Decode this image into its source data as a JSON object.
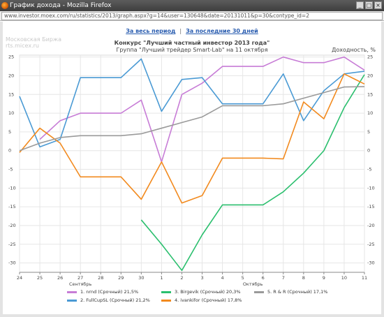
{
  "window": {
    "title": "График дохода - Mozilla Firefox",
    "url": "www.investor.moex.com/ru/statistics/2013/graph.aspx?g=14&user=130648&date=20131011&p=30&contype_id=2"
  },
  "nav": {
    "all_period": "За весь период",
    "separator": "|",
    "last_30_days": "За последние 30 дней"
  },
  "watermark": {
    "line1": "Московская Биржа",
    "line2": "rts.micex.ru"
  },
  "chart_data": {
    "type": "line",
    "title": "Конкурс \"Лучший частный инвестор 2013 года\"",
    "subtitle": "Группа \"Лучший трейдер Smart-Lab\" на 11 октября",
    "ylabel": "Доходность, %",
    "categories": [
      "24",
      "25",
      "26",
      "27",
      "28",
      "29",
      "30",
      "1",
      "2",
      "3",
      "4",
      "5",
      "6",
      "7",
      "8",
      "9",
      "10",
      "11"
    ],
    "month_labels": [
      {
        "text": "Сентябрь",
        "index": 3
      },
      {
        "text": "Октябрь",
        "index": 11.5
      }
    ],
    "yticks": [
      25,
      20,
      15,
      10,
      5,
      0,
      -5,
      -10,
      -15,
      -20,
      -25,
      -30
    ],
    "ylim": [
      -32.5,
      25.5
    ],
    "grid": true,
    "legend_position": "bottom",
    "series": [
      {
        "name": "1. nrnd (Срочный)",
        "value": "21,5%",
        "color": "#c77cd6",
        "values": [
          null,
          null,
          3,
          8,
          10,
          10,
          10,
          13.5,
          -3,
          15,
          18,
          22.5,
          22.5,
          22.5,
          25,
          23.5,
          23.5,
          25,
          21.5
        ]
      },
      {
        "name": "2. FullCupSL (Срочный)",
        "value": "21,2%",
        "color": "#4a9ad4",
        "values": [
          null,
          14.5,
          1,
          3,
          19.5,
          19.5,
          19.5,
          24.5,
          10.5,
          19,
          19.5,
          12.5,
          12.5,
          12.5,
          20.5,
          8,
          16,
          20.5,
          21.2
        ]
      },
      {
        "name": "3. Birgevik (Срочный)",
        "value": "20,3%",
        "color": "#2bbf6e",
        "values": [
          null,
          null,
          null,
          null,
          null,
          null,
          null,
          -18.5,
          -25,
          -32,
          -22.5,
          -14.5,
          -14.5,
          -14.5,
          -11,
          -6,
          0,
          11.5,
          20.3
        ]
      },
      {
        "name": "4. ivankifor (Срочный)",
        "value": "17,8%",
        "color": "#f28a1e",
        "values": [
          null,
          -0.5,
          6,
          2,
          -7,
          -7,
          -7,
          -13,
          -3,
          -14,
          -12,
          -2,
          -2,
          -2,
          -2.2,
          13,
          8.5,
          20.5,
          17.8
        ]
      },
      {
        "name": "5. R & R (Срочный)",
        "value": "17,1%",
        "color": "#9a9a9a",
        "values": [
          null,
          0,
          2,
          3.5,
          4,
          4,
          4,
          4.5,
          6,
          7.5,
          9,
          12,
          12,
          12,
          12.5,
          14,
          15.5,
          17,
          17.1
        ]
      }
    ]
  }
}
